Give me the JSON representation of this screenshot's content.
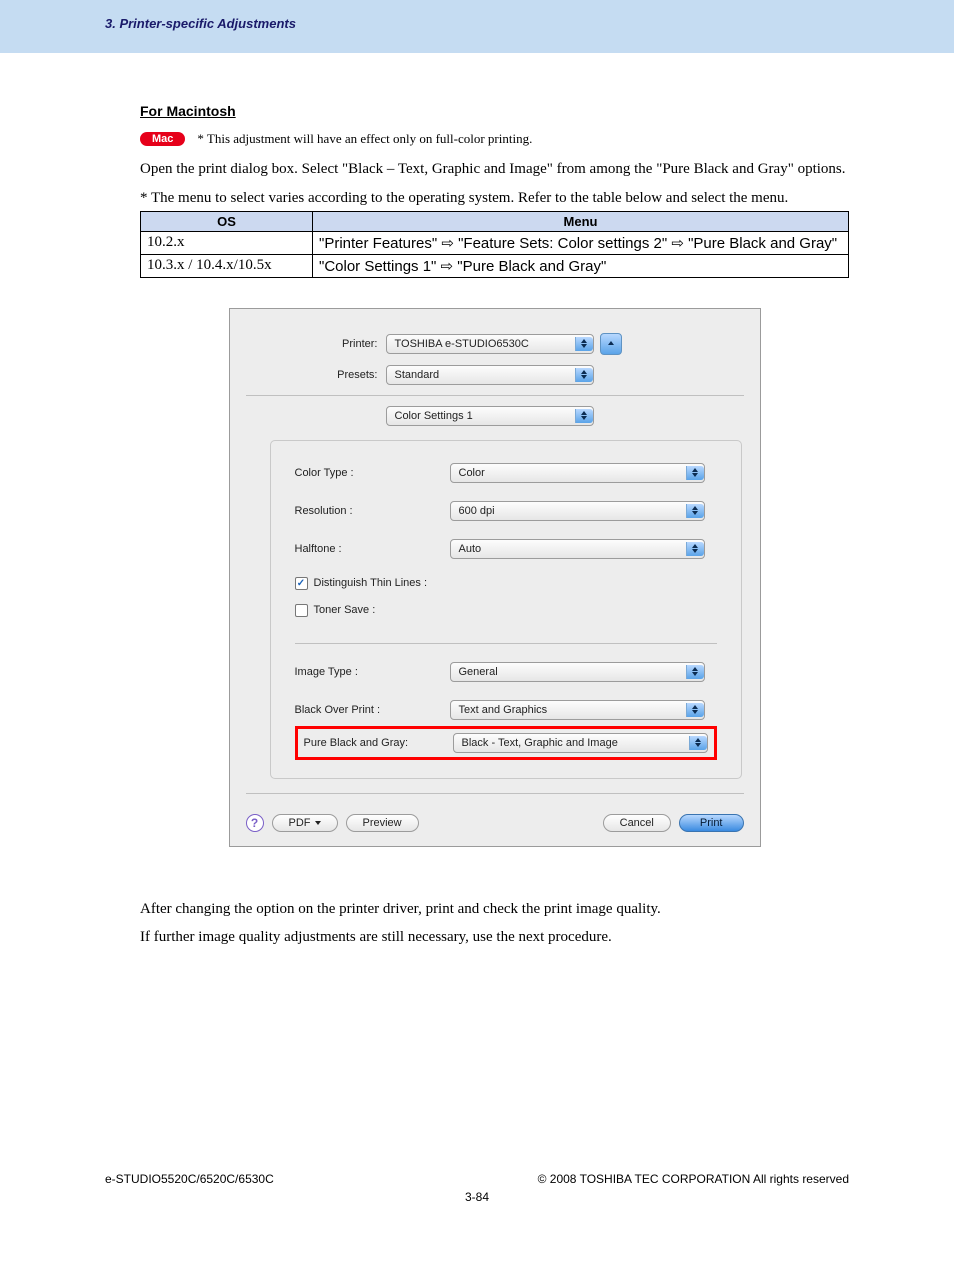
{
  "header_title": "3. Printer-specific Adjustments",
  "section_title": "For Macintosh",
  "mac_badge": "Mac",
  "mac_note": "* This adjustment will have an effect only on full-color printing.",
  "intro_paragraph": "Open the print dialog box.  Select \"Black – Text, Graphic and Image\" from among the \"Pure Black and Gray\" options.",
  "star_note": "* The menu to select varies according to the operating system.  Refer to the table below and select the menu.",
  "os_table": {
    "headers": [
      "OS",
      "Menu"
    ],
    "rows": [
      {
        "os": "10.2.x",
        "menu": "\"Printer Features\" ⇨ \"Feature Sets: Color settings 2\" ⇨ \"Pure Black and Gray\""
      },
      {
        "os": "10.3.x / 10.4.x/10.5x",
        "menu": "\"Color Settings 1\" ⇨ \"Pure Black and Gray\""
      }
    ]
  },
  "dialog": {
    "printer_label": "Printer:",
    "printer_value": "TOSHIBA e-STUDIO6530C",
    "presets_label": "Presets:",
    "presets_value": "Standard",
    "section_value": "Color Settings 1",
    "fields": {
      "color_type_label": "Color Type :",
      "color_type_value": "Color",
      "resolution_label": "Resolution :",
      "resolution_value": "600 dpi",
      "halftone_label": "Halftone :",
      "halftone_value": "Auto",
      "distinguish_label": "Distinguish Thin Lines :",
      "toner_save_label": "Toner Save :",
      "image_type_label": "Image Type :",
      "image_type_value": "General",
      "black_over_label": "Black Over Print :",
      "black_over_value": "Text and Graphics",
      "pure_black_label": "Pure Black and Gray:",
      "pure_black_value": "Black - Text, Graphic and Image"
    },
    "footer": {
      "pdf": "PDF",
      "preview": "Preview",
      "cancel": "Cancel",
      "print": "Print"
    }
  },
  "after_p1": "After changing the option on the printer driver, print and check the print image quality.",
  "after_p2": "If further image quality adjustments are still necessary, use the next procedure.",
  "footer_left": "e-STUDIO5520C/6520C/6530C",
  "footer_right": "© 2008 TOSHIBA TEC CORPORATION All rights reserved",
  "page_num": "3-84"
}
